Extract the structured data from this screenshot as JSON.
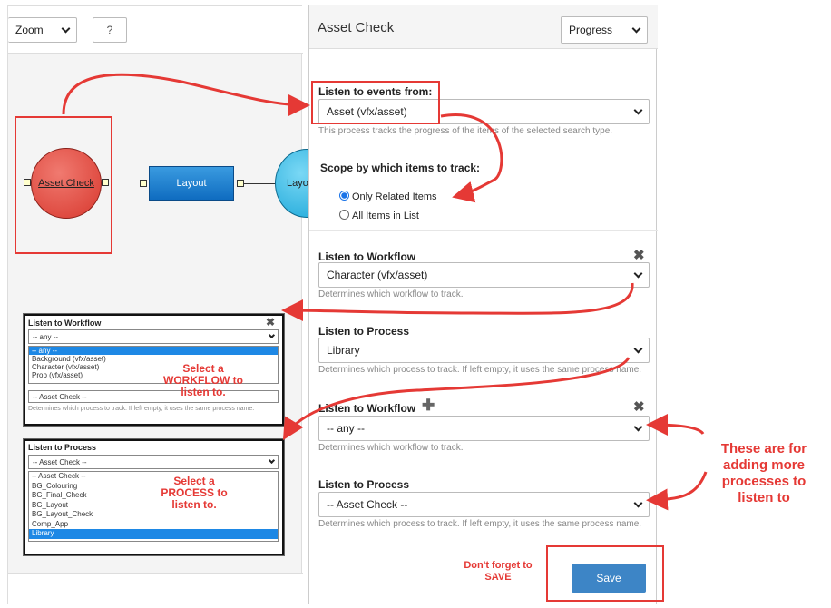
{
  "toolbar": {
    "zoom_label": "Zoom",
    "help_label": "?"
  },
  "graph": {
    "node_asset_check": "Asset Check",
    "node_layout": "Layout",
    "node_layout2": "Layo"
  },
  "panel": {
    "title": "Asset Check",
    "progress_label": "Progress",
    "listen_events_label": "Listen to events from:",
    "listen_events_value": "Asset (vfx/asset)",
    "listen_events_help": "This process tracks the progress of the items of the selected search type.",
    "scope_label": "Scope by which items to track:",
    "radio_only_related": "Only Related Items",
    "radio_all_items": "All Items in List",
    "wf1_label": "Listen to Workflow",
    "wf1_value": "Character (vfx/asset)",
    "wf1_help": "Determines which workflow to track.",
    "proc1_label": "Listen to Process",
    "proc1_value": "Library",
    "proc1_help": "Determines which process to track. If left empty, it uses the same process name.",
    "wf2_label": "Listen to Workflow",
    "wf2_value": "-- any --",
    "wf2_help": "Determines which workflow to track.",
    "proc2_label": "Listen to Process",
    "proc2_value": "-- Asset Check --",
    "proc2_help": "Determines which process to track. If left empty, it uses the same process name.",
    "save_label": "Save"
  },
  "popup_workflow": {
    "label": "Listen to Workflow",
    "value": "-- any --",
    "options": [
      "-- any --",
      "Background (vfx/asset)",
      "Character (vfx/asset)",
      "Prop (vfx/asset)"
    ],
    "under_value": "-- Asset Check --",
    "help": "Determines which process to track. If left empty, it uses the same process name."
  },
  "popup_process": {
    "label": "Listen to Process",
    "value": "-- Asset Check --",
    "options": [
      "-- Asset Check --",
      "BG_Colouring",
      "BG_Final_Check",
      "BG_Layout",
      "BG_Layout_Check",
      "Comp_App",
      "Library"
    ]
  },
  "notes": {
    "select_workflow": "Select a WORKFLOW to listen to.",
    "select_process": "Select a PROCESS to listen to.",
    "more_processes": "These are for adding more processes to listen to",
    "dont_forget": "Don't forget to SAVE"
  },
  "colors": {
    "accent": "#1a73e8",
    "annotation": "#e53935",
    "save_button": "#3d85c6"
  },
  "icons": {
    "close": "close-icon",
    "add": "plus-icon",
    "dropdown": "chevron-down-icon"
  }
}
